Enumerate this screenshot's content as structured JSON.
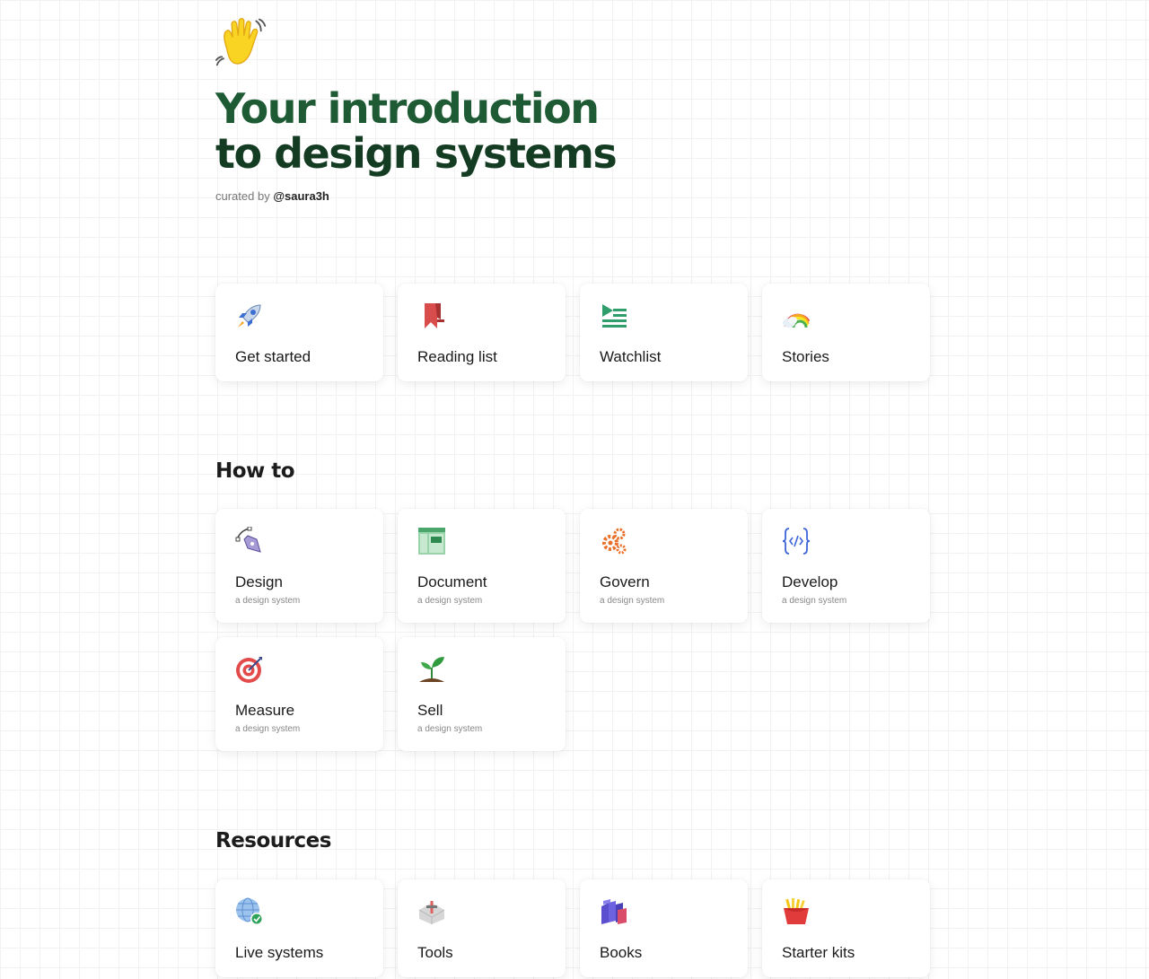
{
  "hero": {
    "title_line1": "Your introduction",
    "title_line2": "to design systems",
    "curated_prefix": "curated by",
    "curated_handle": "@saura3h"
  },
  "quick_links": [
    {
      "label": "Get started",
      "icon": "rocket-icon"
    },
    {
      "label": "Reading list",
      "icon": "bookmark-icon"
    },
    {
      "label": "Watchlist",
      "icon": "playlist-icon"
    },
    {
      "label": "Stories",
      "icon": "rainbow-icon"
    }
  ],
  "how_to": {
    "heading": "How to",
    "items": [
      {
        "label": "Design",
        "sub": "a design system",
        "icon": "pen-tool-icon"
      },
      {
        "label": "Document",
        "sub": "a design system",
        "icon": "document-layout-icon"
      },
      {
        "label": "Govern",
        "sub": "a design system",
        "icon": "gears-icon"
      },
      {
        "label": "Develop",
        "sub": "a design system",
        "icon": "code-icon"
      },
      {
        "label": "Measure",
        "sub": "a design system",
        "icon": "target-icon"
      },
      {
        "label": "Sell",
        "sub": "a design system",
        "icon": "sprout-icon"
      }
    ]
  },
  "resources": {
    "heading": "Resources",
    "items": [
      {
        "label": "Live systems",
        "icon": "globe-check-icon"
      },
      {
        "label": "Tools",
        "icon": "toolbox-icon"
      },
      {
        "label": "Books",
        "icon": "books-icon"
      },
      {
        "label": "Starter kits",
        "icon": "fries-icon"
      }
    ]
  },
  "colors": {
    "title_green": "#1e5a34",
    "title_dark_green": "#133c22"
  }
}
